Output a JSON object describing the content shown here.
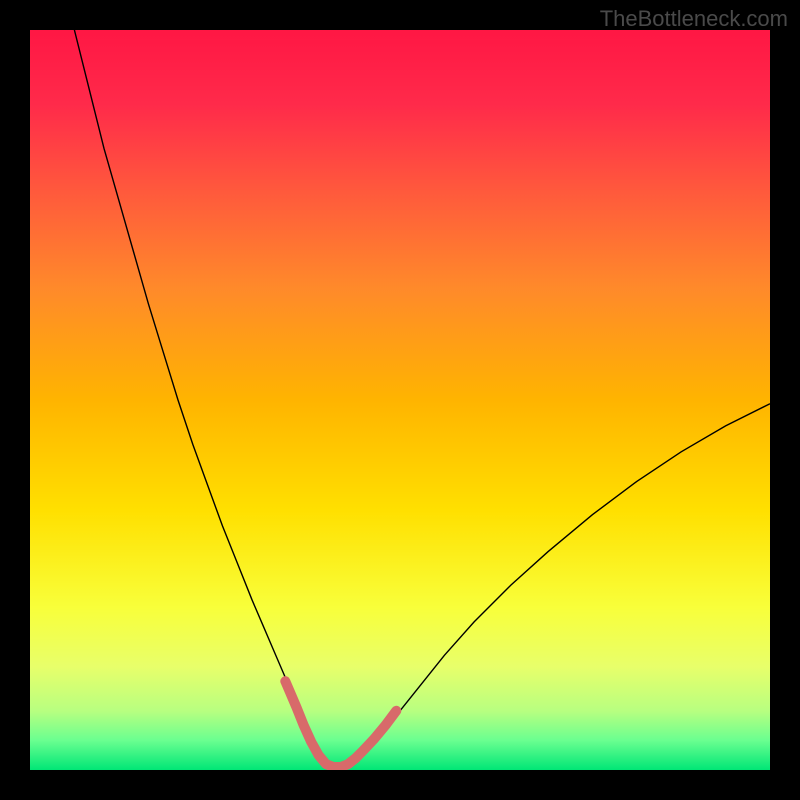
{
  "watermark": "TheBottleneck.com",
  "chart_data": {
    "type": "line",
    "title": "",
    "xlabel": "",
    "ylabel": "",
    "xlim": [
      0,
      100
    ],
    "ylim": [
      0,
      100
    ],
    "background_gradient_stops": [
      {
        "pos": 0.0,
        "color": "#ff1744"
      },
      {
        "pos": 0.1,
        "color": "#ff2a4a"
      },
      {
        "pos": 0.22,
        "color": "#ff5a3c"
      },
      {
        "pos": 0.35,
        "color": "#ff8a2a"
      },
      {
        "pos": 0.5,
        "color": "#ffb400"
      },
      {
        "pos": 0.65,
        "color": "#ffe000"
      },
      {
        "pos": 0.78,
        "color": "#f8ff3a"
      },
      {
        "pos": 0.86,
        "color": "#e8ff6a"
      },
      {
        "pos": 0.92,
        "color": "#b8ff80"
      },
      {
        "pos": 0.96,
        "color": "#6aff90"
      },
      {
        "pos": 1.0,
        "color": "#00e676"
      }
    ],
    "series": [
      {
        "name": "bottleneck-curve",
        "color": "#000000",
        "stroke_width": 1.4,
        "x": [
          6,
          8,
          10,
          12,
          14,
          16,
          18,
          20,
          22,
          24,
          26,
          28,
          30,
          31.5,
          33,
          34.5,
          36,
          37,
          38,
          39,
          40,
          41,
          43,
          45,
          48,
          52,
          56,
          60,
          65,
          70,
          76,
          82,
          88,
          94,
          100
        ],
        "y": [
          100,
          92,
          84,
          77,
          70,
          63,
          56.5,
          50,
          44,
          38.5,
          33,
          28,
          23,
          19.5,
          16,
          12.5,
          9,
          6.5,
          4,
          2,
          0.6,
          0.2,
          0.6,
          2.0,
          5.5,
          10.5,
          15.5,
          20.0,
          25.0,
          29.5,
          34.5,
          39.0,
          43.0,
          46.5,
          49.5
        ]
      },
      {
        "name": "minimum-highlight",
        "color": "#d86a6a",
        "stroke_width": 10,
        "linecap": "round",
        "x": [
          34.5,
          36,
          37,
          38,
          39,
          40,
          41,
          42,
          43,
          44,
          45,
          46.5,
          48,
          49.5
        ],
        "y": [
          12.0,
          8.5,
          6.0,
          3.8,
          2.0,
          0.8,
          0.4,
          0.4,
          0.8,
          1.6,
          2.6,
          4.2,
          6.0,
          8.0
        ]
      }
    ]
  }
}
